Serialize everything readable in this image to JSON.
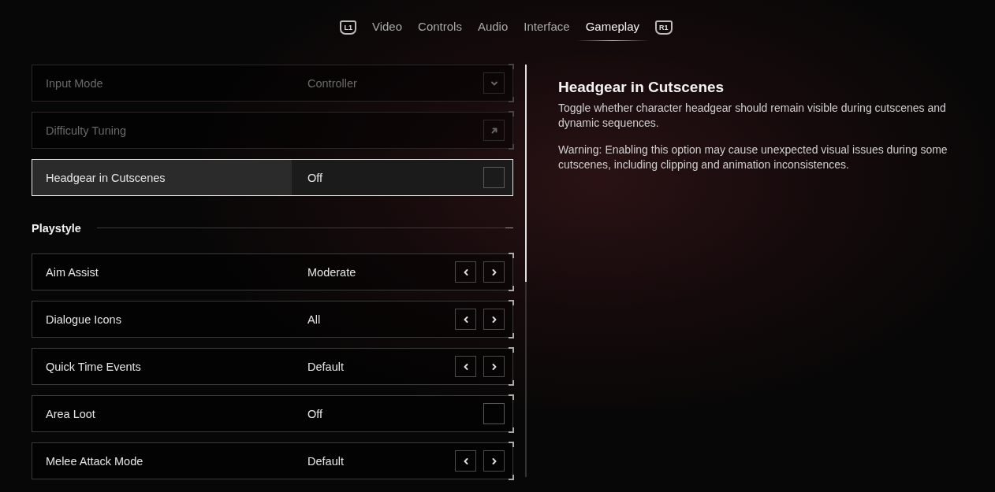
{
  "tabs": {
    "prev_key": "L1",
    "next_key": "R1",
    "items": [
      {
        "label": "Video",
        "selected": false
      },
      {
        "label": "Controls",
        "selected": false
      },
      {
        "label": "Audio",
        "selected": false
      },
      {
        "label": "Interface",
        "selected": false
      },
      {
        "label": "Gameplay",
        "selected": true
      }
    ]
  },
  "settings": [
    {
      "kind": "dropdown",
      "label": "Input Mode",
      "value": "Controller",
      "disabled": true,
      "selected": false
    },
    {
      "kind": "link",
      "label": "Difficulty Tuning",
      "disabled": true,
      "selected": false
    },
    {
      "kind": "toggle",
      "label": "Headgear in Cutscenes",
      "value": "Off",
      "checked": false,
      "disabled": false,
      "selected": true
    },
    {
      "kind": "section",
      "label": "Playstyle"
    },
    {
      "kind": "selector",
      "label": "Aim Assist",
      "value": "Moderate",
      "disabled": false,
      "selected": false
    },
    {
      "kind": "selector",
      "label": "Dialogue Icons",
      "value": "All",
      "disabled": false,
      "selected": false
    },
    {
      "kind": "selector",
      "label": "Quick Time Events",
      "value": "Default",
      "disabled": false,
      "selected": false
    },
    {
      "kind": "toggle",
      "label": "Area Loot",
      "value": "Off",
      "checked": false,
      "disabled": false,
      "selected": false
    },
    {
      "kind": "selector",
      "label": "Melee Attack Mode",
      "value": "Default",
      "disabled": false,
      "selected": false
    }
  ],
  "details": {
    "title": "Headgear in Cutscenes",
    "description": "Toggle whether character headgear should remain visible during cutscenes and dynamic sequences.",
    "warning": "Warning: Enabling this option may cause unexpected visual issues during some cutscenes, including clipping and animation inconsistences."
  }
}
